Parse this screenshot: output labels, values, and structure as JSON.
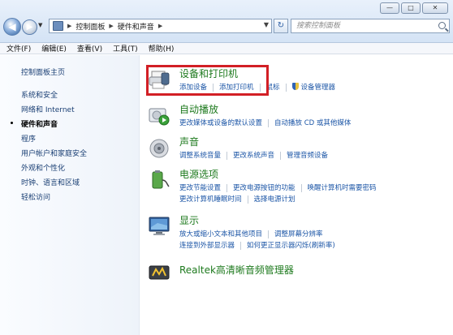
{
  "window": {
    "minimize_label": "—",
    "maximize_label": "□",
    "close_label": "✕"
  },
  "address": {
    "crumbs": [
      "控制面板",
      "硬件和声音"
    ],
    "search_placeholder": "搜索控制面板"
  },
  "menu": [
    "文件(F)",
    "编辑(E)",
    "查看(V)",
    "工具(T)",
    "帮助(H)"
  ],
  "sidebar": {
    "home": "控制面板主页",
    "items": [
      "系统和安全",
      "网络和 Internet",
      "硬件和声音",
      "程序",
      "用户帐户和家庭安全",
      "外观和个性化",
      "时钟、语言和区域",
      "轻松访问"
    ],
    "active_index": 2
  },
  "categories": [
    {
      "title": "设备和打印机",
      "icon": "printer-icon",
      "rows": [
        [
          "添加设备",
          "添加打印机",
          "鼠标",
          "设备管理器"
        ]
      ]
    },
    {
      "title": "自动播放",
      "icon": "autoplay-icon",
      "rows": [
        [
          "更改媒体或设备的默认设置",
          "自动播放 CD 或其他媒体"
        ]
      ]
    },
    {
      "title": "声音",
      "icon": "speaker-icon",
      "rows": [
        [
          "调整系统音量",
          "更改系统声音",
          "管理音频设备"
        ]
      ]
    },
    {
      "title": "电源选项",
      "icon": "power-icon",
      "rows": [
        [
          "更改节能设置",
          "更改电源按钮的功能",
          "唤醒计算机时需要密码"
        ],
        [
          "更改计算机睡眠时间",
          "选择电源计划"
        ]
      ]
    },
    {
      "title": "显示",
      "icon": "monitor-icon",
      "rows": [
        [
          "放大或缩小文本和其他项目",
          "调整屏幕分辨率"
        ],
        [
          "连接到外部显示器",
          "如何更正显示器闪烁(刷新率)"
        ]
      ]
    },
    {
      "title": "Realtek高清晰音频管理器",
      "icon": "realtek-icon",
      "rows": []
    }
  ],
  "colors": {
    "category_title": "#1e7a1e",
    "link": "#1b55a6",
    "highlight_border": "#d21f25"
  }
}
